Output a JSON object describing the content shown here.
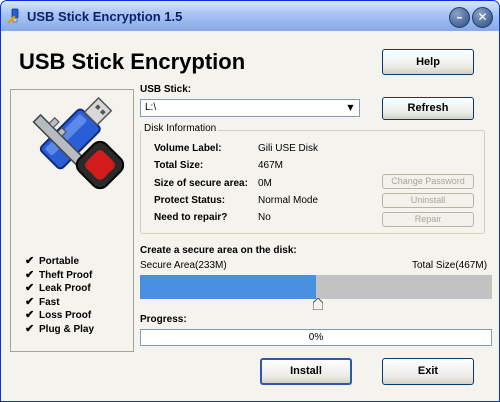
{
  "window": {
    "title": "USB Stick Encryption 1.5"
  },
  "app": {
    "heading": "USB Stick Encryption"
  },
  "buttons": {
    "help": "Help",
    "refresh": "Refresh",
    "change_password": "Change Password",
    "uninstall": "Uninstall",
    "repair": "Repair",
    "install": "Install",
    "exit": "Exit"
  },
  "features": [
    "Portable",
    "Theft Proof",
    "Leak Proof",
    "Fast",
    "Loss Proof",
    "Plug & Play"
  ],
  "usb": {
    "label": "USB Stick:",
    "selected": "L:\\"
  },
  "disk_info": {
    "title": "Disk Information",
    "rows": [
      {
        "label": "Volume Label:",
        "value": "Gili USE Disk"
      },
      {
        "label": "Total Size:",
        "value": "467M"
      },
      {
        "label": "Size of secure area:",
        "value": "0M"
      },
      {
        "label": "Protect Status:",
        "value": "Normal Mode"
      },
      {
        "label": "Need to repair?",
        "value": "No"
      }
    ]
  },
  "secure_area": {
    "heading": "Create a secure area on the disk:",
    "left_label": "Secure Area(233M)",
    "right_label": "Total Size(467M)",
    "secure_mb": 233,
    "total_mb": 467
  },
  "progress": {
    "label": "Progress:",
    "value_text": "0%",
    "value": 0
  },
  "colors": {
    "secure_fill": "#4a90e2",
    "remaining": "#c2c2c2"
  }
}
